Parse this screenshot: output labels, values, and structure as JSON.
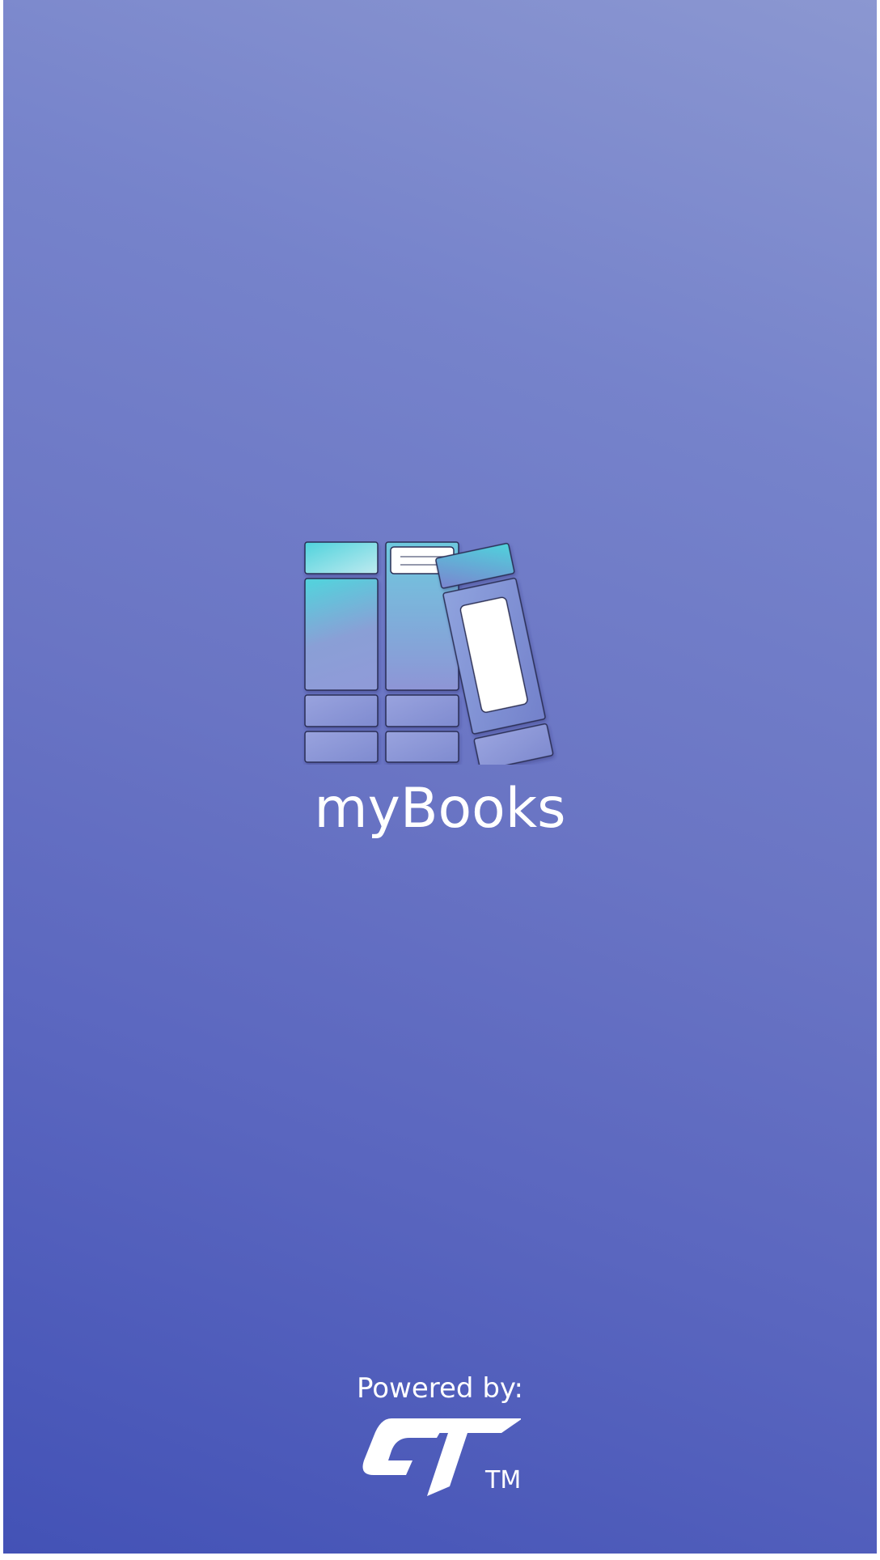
{
  "splash": {
    "app_name": "myBooks",
    "logo_icon": "books-on-shelf-icon",
    "powered_by_label": "Powered by:",
    "brand_logo_icon": "ct-brand-logo",
    "brand_logo_text": "CT",
    "trademark": "TM"
  },
  "colors": {
    "gradient_top": "#8b97d1",
    "gradient_bottom": "#4352b6",
    "text": "#ffffff",
    "book_teal": "#4fd3dc"
  }
}
